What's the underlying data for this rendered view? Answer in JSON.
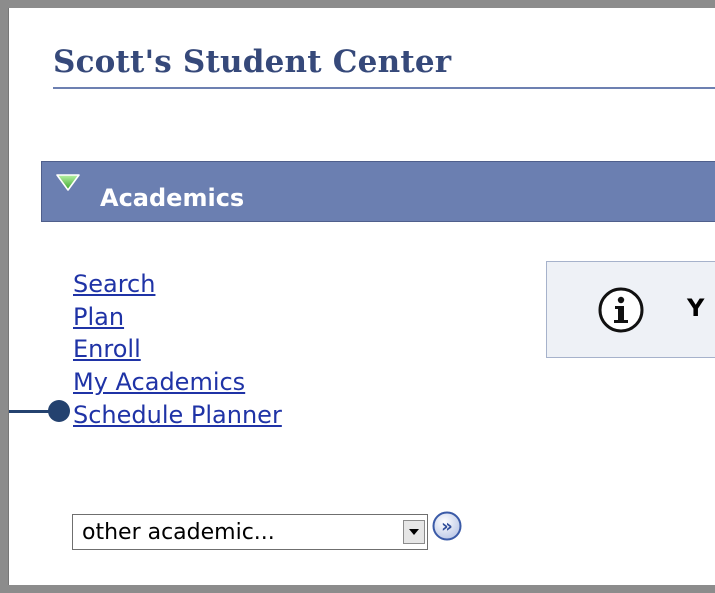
{
  "header": {
    "title": "Scott's Student Center"
  },
  "academics": {
    "section_title": "Academics",
    "links": [
      {
        "label": "Search"
      },
      {
        "label": "Plan"
      },
      {
        "label": "Enroll"
      },
      {
        "label": "My Academics"
      },
      {
        "label": "Schedule Planner"
      }
    ],
    "other_academic_select": {
      "value": "other academic..."
    },
    "go_button_glyph": "»"
  },
  "info_box": {
    "text": "Y"
  },
  "icons": [
    "expand-triangle-icon",
    "info-icon",
    "dropdown-arrow-icon",
    "go-arrow-icon"
  ],
  "colors": {
    "header_bar": "#6b7fb1",
    "title": "#36497a",
    "link": "#1f33a6",
    "callout": "#24426f",
    "info_bg": "#eef1f6"
  }
}
